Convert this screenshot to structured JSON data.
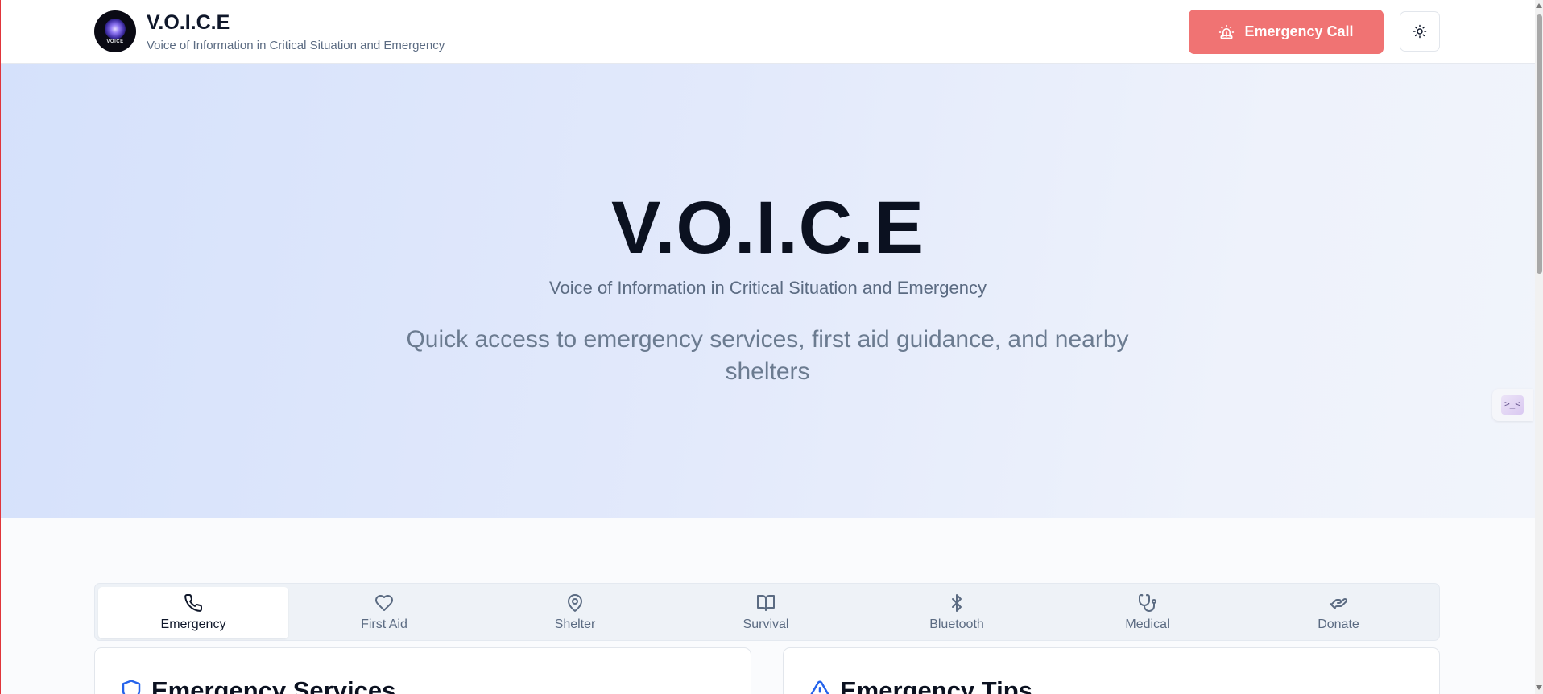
{
  "header": {
    "logo_text": "VOICE",
    "title": "V.O.I.C.E",
    "subtitle": "Voice of Information in Critical Situation and Emergency",
    "emergency_call_label": "Emergency Call",
    "emergency_icon": "siren-icon",
    "theme_icon": "sun-icon"
  },
  "hero": {
    "title": "V.O.I.C.E",
    "subtitle": "Voice of Information in Critical Situation and Emergency",
    "description": "Quick access to emergency services, first aid guidance, and nearby shelters"
  },
  "side_widget": {
    "glyph": ">_<"
  },
  "tabs": [
    {
      "label": "Emergency",
      "icon": "phone-icon",
      "active": true
    },
    {
      "label": "First Aid",
      "icon": "heart-icon",
      "active": false
    },
    {
      "label": "Shelter",
      "icon": "map-pin-icon",
      "active": false
    },
    {
      "label": "Survival",
      "icon": "book-open-icon",
      "active": false
    },
    {
      "label": "Bluetooth",
      "icon": "bluetooth-icon",
      "active": false
    },
    {
      "label": "Medical",
      "icon": "stethoscope-icon",
      "active": false
    },
    {
      "label": "Donate",
      "icon": "hand-heart-icon",
      "active": false
    }
  ],
  "cards": {
    "services_title": "Emergency Services",
    "services_icon": "shield-icon",
    "tips_title": "Emergency Tips",
    "tips_icon": "alert-triangle-icon"
  },
  "colors": {
    "accent_red": "#f07373",
    "active_icon_blue": "#2563eb",
    "text_dark": "#0f172a",
    "text_muted": "#5b6b82"
  }
}
